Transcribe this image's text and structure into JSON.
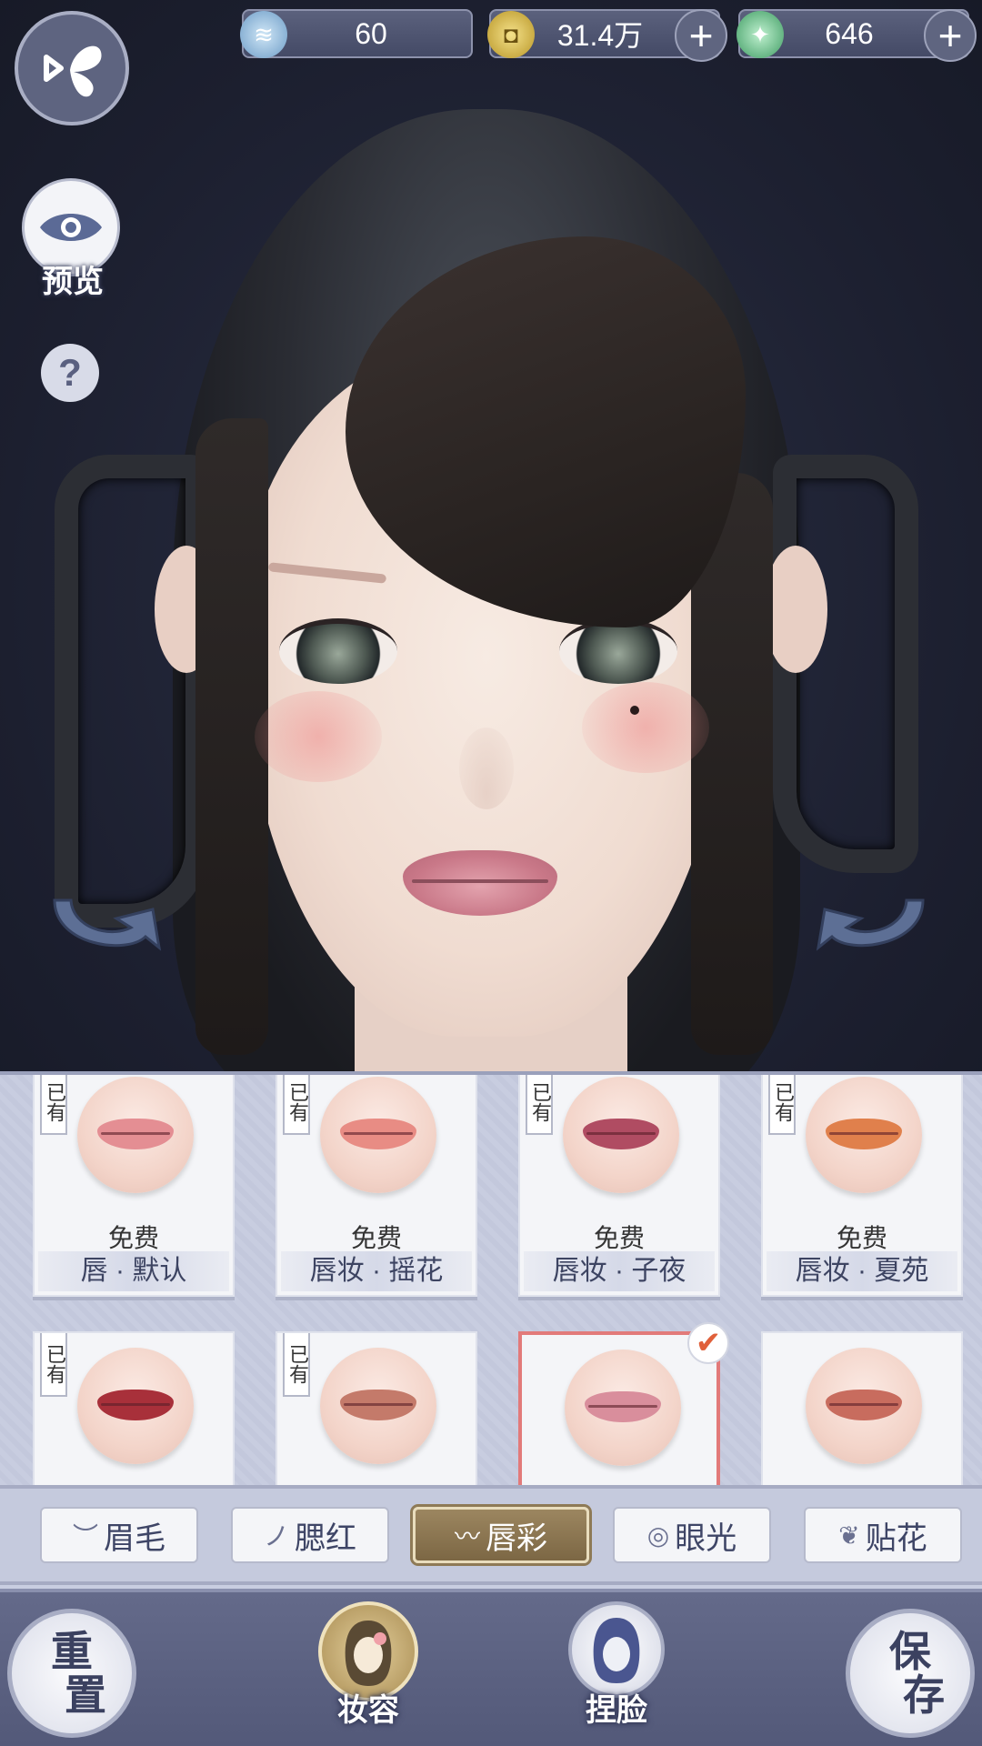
{
  "currency": {
    "jade": {
      "value": "60",
      "icon": "jade-coin-icon",
      "color": "#7fb3d9"
    },
    "gold": {
      "value": "31.4万",
      "icon": "gold-coin-icon",
      "color": "#d8b640"
    },
    "token": {
      "value": "646",
      "icon": "jade-token-icon",
      "color": "#5fc087"
    }
  },
  "side": {
    "preview_label": "预览",
    "help_label": "?"
  },
  "lip_items": [
    {
      "owned": "已有",
      "price": "免费",
      "name": "唇 · 默认",
      "lip_color": "#e48e93"
    },
    {
      "owned": "已有",
      "price": "免费",
      "name": "唇妆 · 摇花",
      "lip_color": "#e88c84"
    },
    {
      "owned": "已有",
      "price": "免费",
      "name": "唇妆 · 子夜",
      "lip_color": "#b04c62"
    },
    {
      "owned": "已有",
      "price": "免费",
      "name": "唇妆 · 夏苑",
      "lip_color": "#e0804c"
    },
    {
      "owned": "已有",
      "price": "",
      "name": "",
      "lip_color": "#a8303a"
    },
    {
      "owned": "已有",
      "price": "",
      "name": "",
      "lip_color": "#c47a6a"
    },
    {
      "owned": "",
      "price": "",
      "name": "",
      "lip_color": "#d98e9c",
      "selected": true
    },
    {
      "owned": "",
      "price": "",
      "name": "",
      "lip_color": "#c86c5e"
    }
  ],
  "tabs": [
    {
      "label": "眉毛",
      "icon": "eyebrow-icon",
      "glyph": "︶"
    },
    {
      "label": "腮红",
      "icon": "blush-icon",
      "glyph": "ノ"
    },
    {
      "label": "唇彩",
      "icon": "lips-icon",
      "glyph": "〰",
      "active": true
    },
    {
      "label": "眼光",
      "icon": "eye-light-icon",
      "glyph": "◎"
    },
    {
      "label": "贴花",
      "icon": "decal-icon",
      "glyph": "❦"
    }
  ],
  "bottom_nav": {
    "reset_line1": "重",
    "reset_line2": "置",
    "makeup_label": "妆容",
    "face_label": "捏脸",
    "save_line1": "保",
    "save_line2": "存"
  }
}
